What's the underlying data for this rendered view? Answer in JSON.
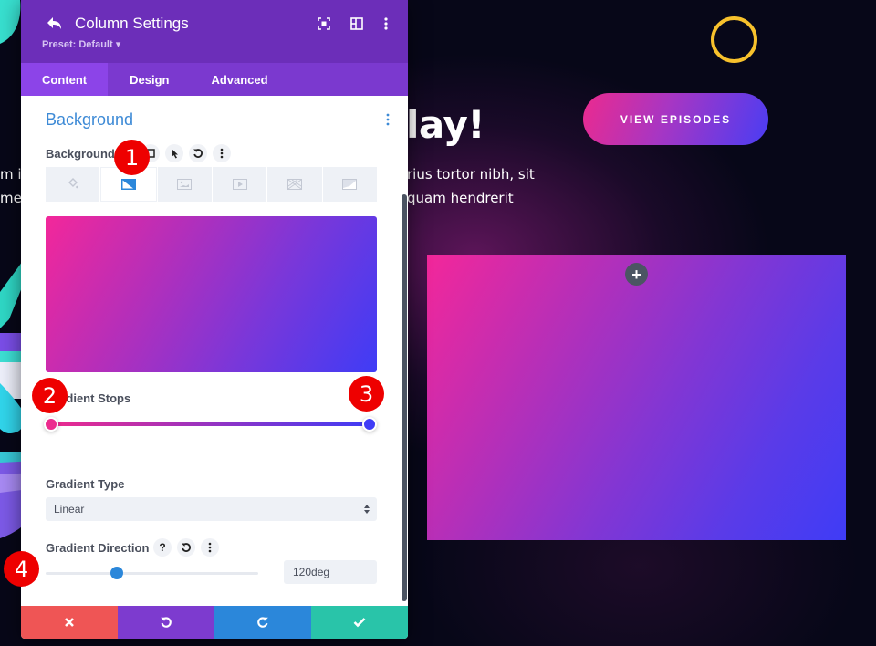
{
  "website": {
    "hero_heading_fragment": "lay!",
    "hero_text_right": [
      "rius tortor nibh, sit",
      "quam hendrerit"
    ],
    "hero_text_left": [
      "m i",
      "met"
    ],
    "cta_label": "VIEW EPISODES",
    "add_row_label": "+",
    "colors": {
      "bg": "#070718",
      "ring": "#f7c12c",
      "gradient_start": "#f3279a",
      "gradient_end": "#3f3cf6"
    }
  },
  "panel": {
    "title": "Column Settings",
    "preset": "Preset: Default ▾",
    "header_icons": [
      "focus-mode-icon",
      "split-view-icon",
      "more-options-icon"
    ],
    "tabs": [
      {
        "label": "Content",
        "active": true
      },
      {
        "label": "Design",
        "active": false
      },
      {
        "label": "Advanced",
        "active": false
      }
    ],
    "section_title": "Background",
    "background_label": "Background",
    "background_types": [
      {
        "name": "color",
        "active": false
      },
      {
        "name": "gradient",
        "active": true
      },
      {
        "name": "image",
        "active": false
      },
      {
        "name": "video",
        "active": false
      },
      {
        "name": "pattern",
        "active": false
      },
      {
        "name": "mask",
        "active": false
      }
    ],
    "gradient_stops_label": "Gradient Stops",
    "gradient_stops": [
      {
        "color": "#ec2a8e",
        "position_percent": 0
      },
      {
        "color": "#3f3cf6",
        "position_percent": 100
      }
    ],
    "gradient_type_label": "Gradient Type",
    "gradient_type_value": "Linear",
    "gradient_direction_label": "Gradient Direction",
    "gradient_direction_value": "120deg",
    "gradient_direction_degrees": 120,
    "footer_buttons": [
      {
        "name": "cancel",
        "color": "#ef5555"
      },
      {
        "name": "undo",
        "color": "#7d3bcf"
      },
      {
        "name": "redo",
        "color": "#2b87da"
      },
      {
        "name": "save",
        "color": "#29c4a9"
      }
    ],
    "colors": {
      "header": "#6c2eb9",
      "tabs": "#7b39cf",
      "active_tab": "#8c44e8",
      "section_title": "#3d8ad6",
      "accent": "#2b87da"
    }
  },
  "annotations": [
    {
      "number": "1",
      "target": "gradient-tab"
    },
    {
      "number": "2",
      "target": "first-gradient-stop"
    },
    {
      "number": "3",
      "target": "last-gradient-stop"
    },
    {
      "number": "4",
      "target": "gradient-direction-slider"
    }
  ]
}
